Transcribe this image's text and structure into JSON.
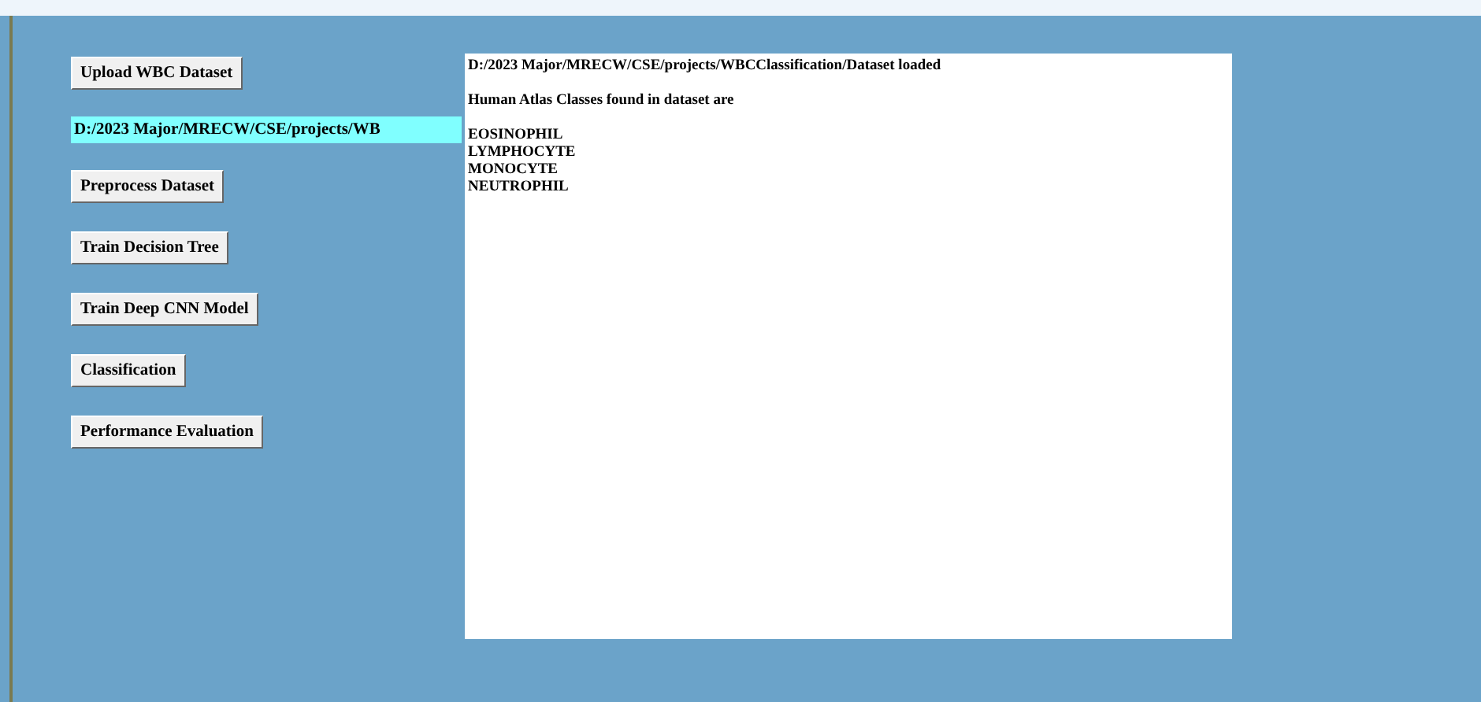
{
  "buttons_top": [
    {
      "label": "Upload WBC Dataset"
    }
  ],
  "path_label": "D:/2023 Major/MRECW/CSE/projects/WB",
  "buttons": [
    {
      "label": "Preprocess Dataset"
    },
    {
      "label": "Train Decision Tree"
    },
    {
      "label": "Train Deep CNN Model"
    },
    {
      "label": "Classification"
    },
    {
      "label": "Performance Evaluation"
    }
  ],
  "output": {
    "paragraphs": [
      [
        "D:/2023 Major/MRECW/CSE/projects/WBCClassification/Dataset loaded"
      ],
      [
        "Human Atlas Classes found in dataset are"
      ],
      [
        "EOSINOPHIL",
        "LYMPHOCYTE",
        "MONOCYTE",
        "NEUTROPHIL"
      ]
    ]
  }
}
